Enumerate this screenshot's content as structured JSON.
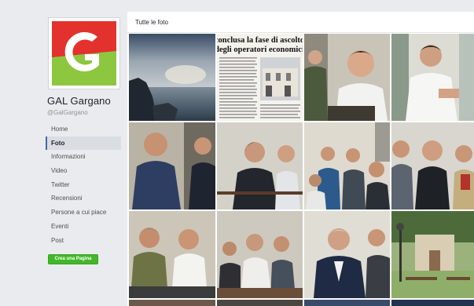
{
  "page": {
    "name": "GAL Gargano",
    "handle": "@GalGargano",
    "logo_letter": "G"
  },
  "nav": {
    "items": [
      {
        "label": "Home",
        "active": false
      },
      {
        "label": "Foto",
        "active": true
      },
      {
        "label": "Informazioni",
        "active": false
      },
      {
        "label": "Video",
        "active": false
      },
      {
        "label": "Twitter",
        "active": false
      },
      {
        "label": "Recensioni",
        "active": false
      },
      {
        "label": "Persone a cui piace",
        "active": false
      },
      {
        "label": "Eventi",
        "active": false
      },
      {
        "label": "Post",
        "active": false
      }
    ],
    "create_page_label": "Crea una Pagina"
  },
  "photos": {
    "section_title": "Tutte le foto",
    "newspaper_headline_1": "conclusa la fase di ascolto",
    "newspaper_headline_2": "degli operatori economici",
    "items": [
      {
        "name": "photo-sea-sunset"
      },
      {
        "name": "photo-newspaper-clipping"
      },
      {
        "name": "photo-meeting-speaker"
      },
      {
        "name": "photo-man-white-shirt"
      },
      {
        "name": "photo-man-blue-shirt"
      },
      {
        "name": "photo-audience-seated"
      },
      {
        "name": "photo-audience-hall"
      },
      {
        "name": "photo-men-group"
      },
      {
        "name": "photo-two-men-seated"
      },
      {
        "name": "photo-audience-rows"
      },
      {
        "name": "photo-man-dark-jacket"
      },
      {
        "name": "photo-town-square"
      }
    ]
  },
  "colors": {
    "accent": "#4267b2",
    "button_green": "#42b72a",
    "logo_red": "#e3312d",
    "logo_green": "#8dc63f"
  }
}
